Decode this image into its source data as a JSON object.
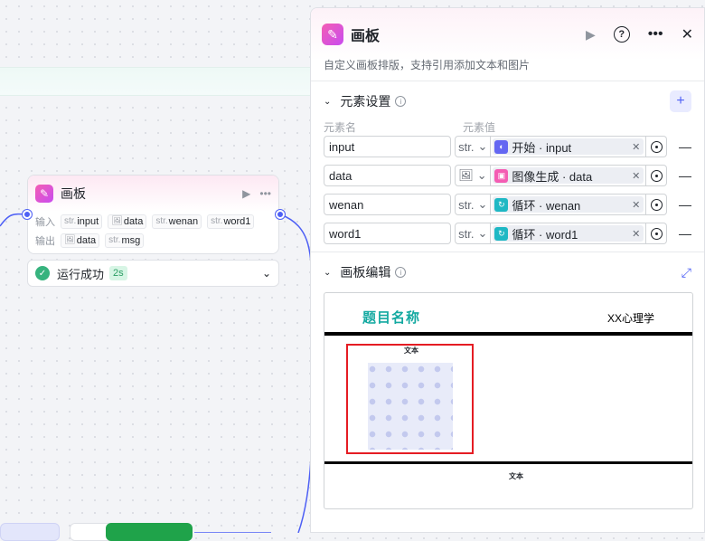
{
  "node": {
    "title": "画板",
    "input_label": "输入",
    "output_label": "输出",
    "inputs": [
      {
        "type": "str.",
        "name": "input"
      },
      {
        "type": "img",
        "name": "data"
      },
      {
        "type": "str.",
        "name": "wenan"
      },
      {
        "type": "str.",
        "name": "word1"
      }
    ],
    "outputs": [
      {
        "type": "img",
        "name": "data"
      },
      {
        "type": "str.",
        "name": "msg"
      }
    ]
  },
  "status": {
    "text": "运行成功",
    "duration": "2s"
  },
  "panel": {
    "title": "画板",
    "description": "自定义画板排版，支持引用添加文本和图片",
    "elements_section": "元素设置",
    "col_name": "元素名",
    "col_value": "元素值",
    "rows": [
      {
        "name": "input",
        "type": "str.",
        "ref": "开始 · input",
        "ref_icon": "start-icon",
        "ref_color": "#6467f2"
      },
      {
        "name": "data",
        "type": "img",
        "ref": "图像生成 · data",
        "ref_icon": "image-icon",
        "ref_color": "#f45db3"
      },
      {
        "name": "wenan",
        "type": "str.",
        "ref": "循环 · wenan",
        "ref_icon": "loop-icon",
        "ref_color": "#1fb8c4"
      },
      {
        "name": "word1",
        "type": "str.",
        "ref": "循环 · word1",
        "ref_icon": "loop-icon",
        "ref_color": "#1fb8c4"
      }
    ],
    "editor_section": "画板编辑",
    "canvas": {
      "title": "题目名称",
      "subtitle": "XX心理学",
      "text_top": "文本",
      "text_bottom": "文本"
    }
  },
  "colors": {
    "accent": "#4e60f5",
    "brand": "#f45db3",
    "success": "#36b37e",
    "title_teal": "#14a9a1",
    "selection": "#e51c23"
  }
}
